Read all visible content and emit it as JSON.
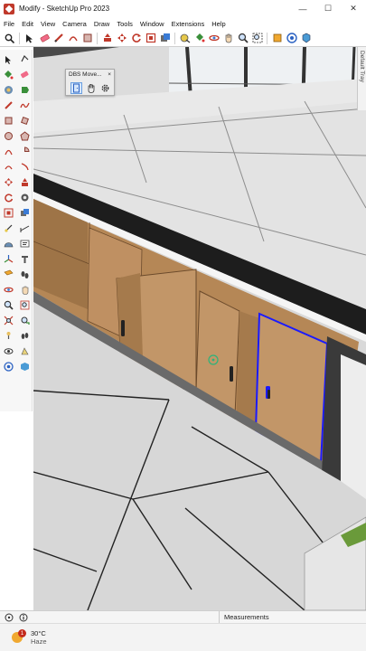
{
  "window": {
    "title": "Modify - SketchUp Pro 2023",
    "controls": {
      "minimize": "—",
      "maximize": "☐",
      "close": "✕"
    }
  },
  "menu": [
    "File",
    "Edit",
    "View",
    "Camera",
    "Draw",
    "Tools",
    "Window",
    "Extensions",
    "Help"
  ],
  "toolbar": {
    "icons": [
      "search-icon",
      "select-arrow-icon",
      "eraser-icon",
      "pencil-icon",
      "arc-icon",
      "rectangle-icon",
      "push-pull-icon",
      "move-icon",
      "rotate-icon",
      "scale-icon",
      "offset-icon",
      "tape-measure-icon",
      "paint-bucket-icon",
      "orbit-icon",
      "pan-icon",
      "zoom-icon",
      "zoom-extents-icon",
      "section-icon",
      "warehouse-icon",
      "extension-icon"
    ]
  },
  "palette": {
    "icons": [
      "select-icon",
      "lasso-icon",
      "paint-icon",
      "eraser-icon",
      "component-icon",
      "tag-icon",
      "pencil-icon",
      "freehand-icon",
      "rectangle-icon",
      "rotated-rectangle-icon",
      "circle-icon",
      "polygon-icon",
      "arc-icon",
      "pie-icon",
      "arc2-icon",
      "arc3-icon",
      "move-icon",
      "push-pull-icon",
      "rotate-icon",
      "follow-me-icon",
      "scale-icon",
      "offset-icon",
      "tape-icon",
      "dimension-icon",
      "protractor-icon",
      "text-icon",
      "axes-icon",
      "3d-text-icon",
      "section-plane-icon",
      "walk-icon",
      "orbit-icon",
      "pan-icon",
      "zoom-icon",
      "zoom-window-icon",
      "zoom-extents-icon",
      "previous-view-icon",
      "position-camera-icon",
      "look-around-icon",
      "eye-icon",
      "sandbox-icon",
      "warehouse-icon",
      "extension-icon"
    ]
  },
  "dbs_panel": {
    "title": "DBS Move...",
    "close": "×"
  },
  "tray": {
    "label": "Default Tray"
  },
  "statusbar": {
    "measurements_label": "Measurements"
  },
  "taskbar": {
    "temperature": "30°C",
    "condition": "Haze",
    "badge": "1"
  },
  "colors": {
    "accent_blue": "#2a61c2",
    "selection_blue": "#1a1aff",
    "wood": "#b98a5c",
    "countertop": "#e3e3e3"
  }
}
